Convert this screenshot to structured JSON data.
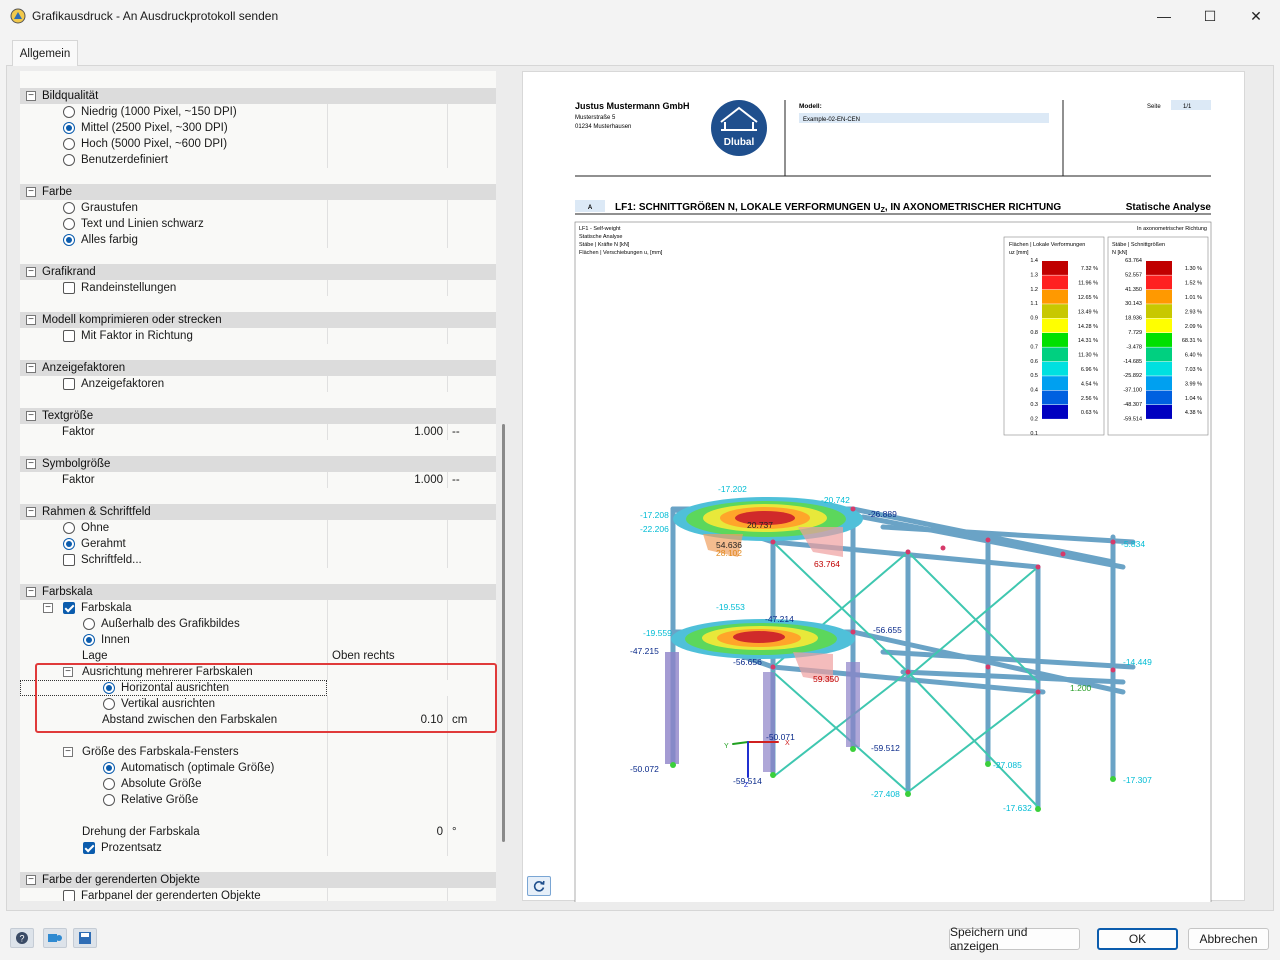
{
  "window": {
    "title": "Grafikausdruck - An Ausdruckprotokoll senden",
    "minimize": "—",
    "maximize": "☐",
    "close": "✕"
  },
  "tabs": [
    {
      "label": "Allgemein"
    }
  ],
  "tree": {
    "bildqualitaet": {
      "label": "Bildqualität",
      "options": [
        {
          "label": "Niedrig (1000 Pixel, ~150 DPI)",
          "selected": false
        },
        {
          "label": "Mittel (2500 Pixel, ~300 DPI)",
          "selected": true
        },
        {
          "label": "Hoch (5000 Pixel, ~600 DPI)",
          "selected": false
        },
        {
          "label": "Benutzerdefiniert",
          "selected": false
        }
      ]
    },
    "farbe": {
      "label": "Farbe",
      "options": [
        {
          "label": "Graustufen",
          "selected": false
        },
        {
          "label": "Text und Linien schwarz",
          "selected": false
        },
        {
          "label": "Alles farbig",
          "selected": true
        }
      ]
    },
    "grafikrand": {
      "label": "Grafikrand",
      "checkbox": "Randeinstellungen",
      "checked": false
    },
    "modell": {
      "label": "Modell komprimieren oder strecken",
      "checkbox": "Mit Faktor in Richtung",
      "checked": false
    },
    "anzeigefaktoren": {
      "label": "Anzeigefaktoren",
      "checkbox": "Anzeigefaktoren",
      "checked": false
    },
    "textgroesse": {
      "label": "Textgröße",
      "field": "Faktor",
      "value": "1.000",
      "unit": "--"
    },
    "symbolgroesse": {
      "label": "Symbolgröße",
      "field": "Faktor",
      "value": "1.000",
      "unit": "--"
    },
    "rahmen": {
      "label": "Rahmen & Schriftfeld",
      "options": [
        {
          "label": "Ohne",
          "selected": false
        },
        {
          "label": "Gerahmt",
          "selected": true
        }
      ],
      "checkbox": "Schriftfeld...",
      "checked": false
    },
    "farbskala": {
      "label": "Farbskala",
      "checkbox": "Farbskala",
      "checked": true,
      "pos_options": [
        {
          "label": "Außerhalb des Grafikbildes",
          "selected": false
        },
        {
          "label": "Innen",
          "selected": true
        }
      ],
      "lage_label": "Lage",
      "lage_value": "Oben rechts",
      "ausrichtung": {
        "label": "Ausrichtung mehrerer Farbskalen",
        "options": [
          {
            "label": "Horizontal ausrichten",
            "selected": true
          },
          {
            "label": "Vertikal ausrichten",
            "selected": false
          }
        ],
        "abstand_label": "Abstand zwischen den Farbskalen",
        "abstand_value": "0.10",
        "abstand_unit": "cm"
      },
      "fenster": {
        "label": "Größe des Farbskala-Fensters",
        "options": [
          {
            "label": "Automatisch (optimale Größe)",
            "selected": true
          },
          {
            "label": "Absolute Größe",
            "selected": false
          },
          {
            "label": "Relative Größe",
            "selected": false
          }
        ]
      },
      "drehung_label": "Drehung der Farbskala",
      "drehung_value": "0",
      "drehung_unit": "°",
      "prozentsatz": "Prozentsatz",
      "prozentsatz_checked": true
    },
    "gerendert": {
      "label": "Farbe der gerenderten Objekte",
      "checkbox": "Farbpanel der gerenderten Objekte",
      "checked": false
    }
  },
  "preview": {
    "company": "Justus Mustermann GmbH",
    "street": "Musterstraße 5",
    "city": "01234 Musterhausen",
    "logo": "Dlubal",
    "modell_label": "Modell:",
    "modell_value": "Example-02-EN-CEN",
    "seite_label": "Seite",
    "seite_value": "1/1",
    "section_tag": "A",
    "heading": "LF1: SCHNITTGRÖßEN N, LOKALE VERFORMUNGEN U",
    "heading_sub": "Z",
    "heading_tail": ", IN AXONOMETRISCHER RICHTUNG",
    "heading_right": "Statische Analyse",
    "info_lines": [
      "LF1 - Self-weight",
      "Statische Analyse",
      "Stäbe | Kräfte N [kN]",
      "Flächen | Verschiebungen u, [mm]"
    ],
    "axo_note": "In axonometrischer Richtung",
    "legend1": {
      "title1": "Flächen | Lokale Verformungen",
      "title2": "uz [mm]",
      "values": [
        "1.4",
        "1.3",
        "1.2",
        "1.1",
        "0.9",
        "0.8",
        "0.7",
        "0.6",
        "0.5",
        "0.4",
        "0.3",
        "0.2",
        "0.1"
      ],
      "percents": [
        "7.32 %",
        "11.96 %",
        "12.65 %",
        "13.49 %",
        "14.28 %",
        "14.31 %",
        "11.30 %",
        "6.96 %",
        "4.54 %",
        "2.56 %",
        "0.63 %"
      ]
    },
    "legend2": {
      "title1": "Stäbe | Schnittgrößen",
      "title2": "N [kN]",
      "values": [
        "63.764",
        "52.557",
        "41.350",
        "30.143",
        "18.936",
        "7.729",
        "-3.478",
        "-14.685",
        "-25.892",
        "-37.100",
        "-48.307",
        "-59.514"
      ],
      "percents": [
        "1.30 %",
        "1.52 %",
        "1.01 %",
        "2.93 %",
        "2.09 %",
        "68.31 %",
        "6.40 %",
        "7.03 %",
        "3.99 %",
        "1.04 %",
        "4.38 %"
      ]
    },
    "legend_colors": [
      "#c00000",
      "#ff2020",
      "#ff9900",
      "#c8c800",
      "#ffff00",
      "#00e000",
      "#00d080",
      "#00e0e0",
      "#00a0f0",
      "#0060e0",
      "#0000c0",
      "#000090"
    ],
    "model_labels": [
      {
        "t": "-17.202",
        "c": "cyan"
      },
      {
        "t": "-17.208",
        "c": "cyan"
      },
      {
        "t": "-22.206",
        "c": "cyan"
      },
      {
        "t": "-20.742",
        "c": "cyan"
      },
      {
        "t": "-26.889",
        "c": "cyan"
      },
      {
        "t": "20.737",
        "c": "dark"
      },
      {
        "t": "54.636",
        "c": "dark"
      },
      {
        "t": "28.102",
        "c": "orange"
      },
      {
        "t": "63.764",
        "c": "red"
      },
      {
        "t": "-5.834",
        "c": "cyan"
      },
      {
        "t": "-19.553",
        "c": "cyan"
      },
      {
        "t": "-47.214",
        "c": "navy"
      },
      {
        "t": "-19.559",
        "c": "cyan"
      },
      {
        "t": "-47.215",
        "c": "navy"
      },
      {
        "t": "-56.655",
        "c": "navy"
      },
      {
        "t": "-56.656",
        "c": "navy"
      },
      {
        "t": "59.350",
        "c": "red"
      },
      {
        "t": "-14.449",
        "c": "cyan"
      },
      {
        "t": "1.200",
        "c": "green"
      },
      {
        "t": "-50.071",
        "c": "navy"
      },
      {
        "t": "-50.072",
        "c": "navy"
      },
      {
        "t": "-59.514",
        "c": "navy"
      },
      {
        "t": "-59.512",
        "c": "navy"
      },
      {
        "t": "-27.085",
        "c": "cyan"
      },
      {
        "t": "-27.408",
        "c": "cyan"
      },
      {
        "t": "-17.307",
        "c": "cyan"
      },
      {
        "t": "-17.632",
        "c": "cyan"
      }
    ]
  },
  "buttons": {
    "save_show": "Speichern und anzeigen",
    "ok": "OK",
    "cancel": "Abbrechen"
  }
}
